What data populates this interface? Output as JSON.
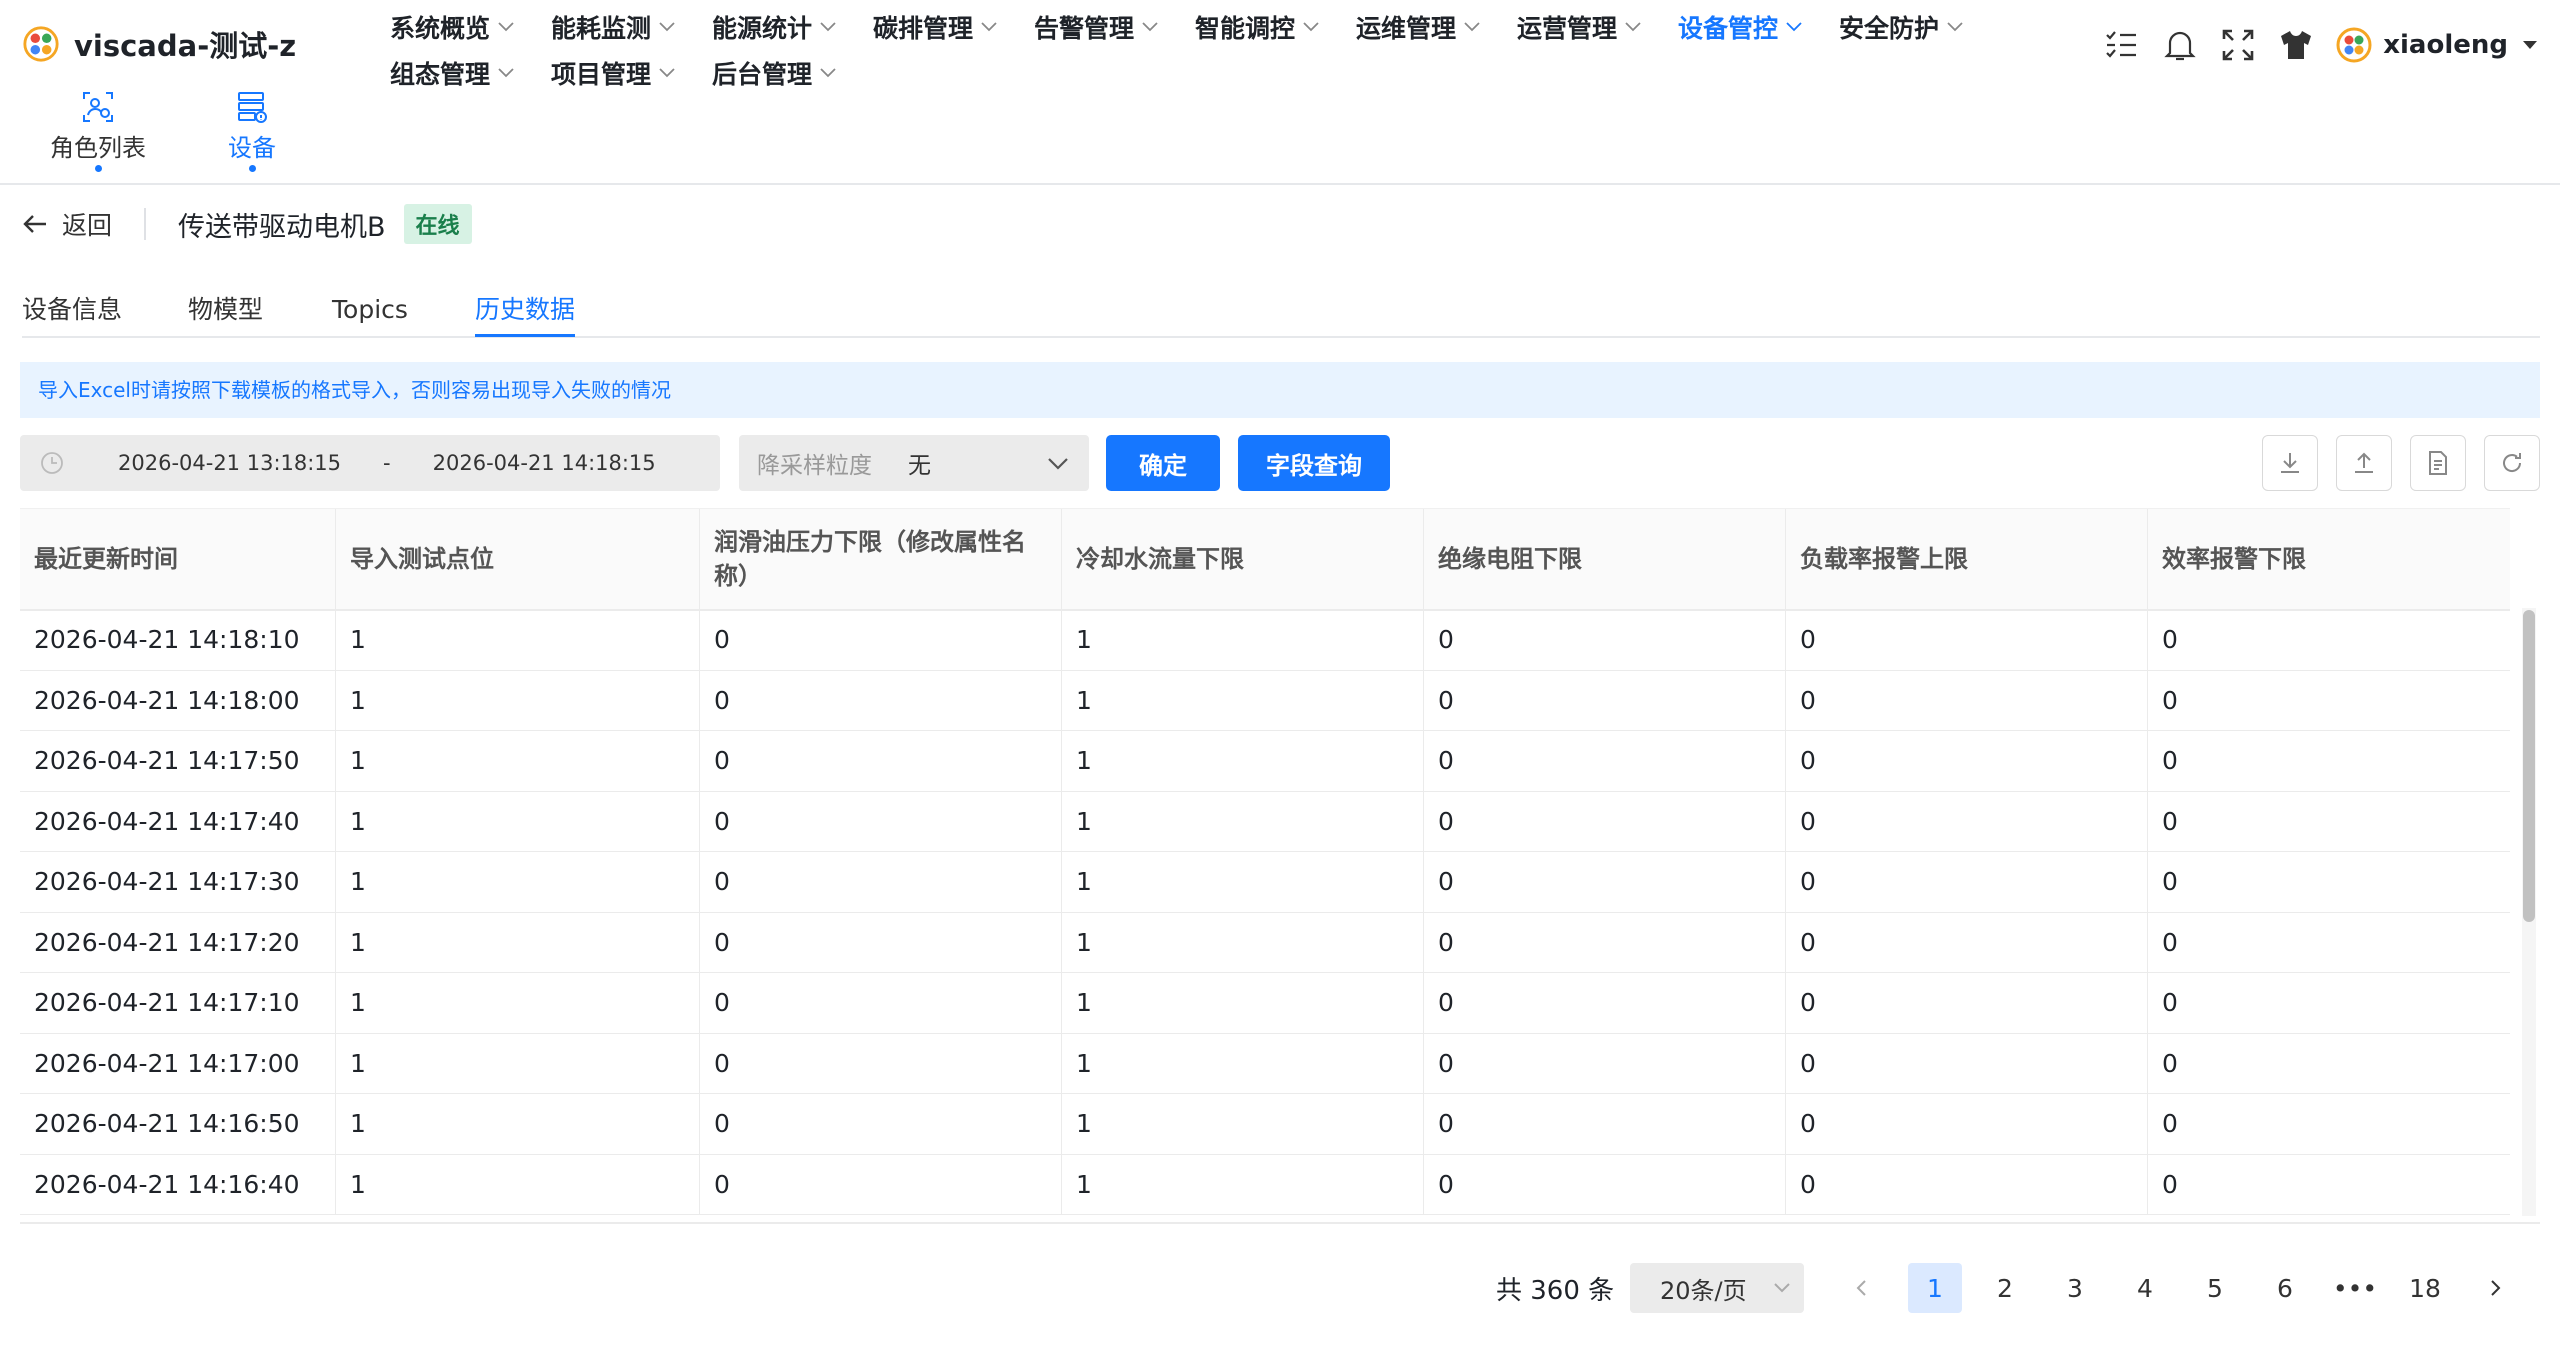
{
  "app": {
    "title": "viscada-测试-z",
    "user": "xiaoleng"
  },
  "nav": {
    "row1": [
      "系统概览",
      "能耗监测",
      "能源统计",
      "碳排管理",
      "告警管理",
      "智能调控",
      "运维管理",
      "运营管理",
      "设备管控",
      "安全防护"
    ],
    "row2": [
      "组态管理",
      "项目管理",
      "后台管理"
    ],
    "active": "设备管控"
  },
  "subnav": {
    "roles": "角色列表",
    "device": "设备"
  },
  "device": {
    "back": "返回",
    "name": "传送带驱动电机B",
    "status": "在线"
  },
  "tabs": [
    "设备信息",
    "物模型",
    "Topics",
    "历史数据"
  ],
  "alert": "导入Excel时请按照下载模板的格式导入，否则容易出现导入失败的情况",
  "filter": {
    "start": "2026-04-21 13:18:15",
    "dash": "-",
    "end": "2026-04-21 14:18:15",
    "sample_placeholder": "降采样粒度",
    "sample_value": "无",
    "confirm": "确定",
    "field_query": "字段查询"
  },
  "table": {
    "columns": [
      "最近更新时间",
      "导入测试点位",
      "润滑油压力下限（修改属性名称）",
      "冷却水流量下限",
      "绝缘电阻下限",
      "负载率报警上限",
      "效率报警下限"
    ],
    "rows": [
      [
        "2026-04-21 14:18:10",
        "1",
        "0",
        "1",
        "0",
        "0",
        "0"
      ],
      [
        "2026-04-21 14:18:00",
        "1",
        "0",
        "1",
        "0",
        "0",
        "0"
      ],
      [
        "2026-04-21 14:17:50",
        "1",
        "0",
        "1",
        "0",
        "0",
        "0"
      ],
      [
        "2026-04-21 14:17:40",
        "1",
        "0",
        "1",
        "0",
        "0",
        "0"
      ],
      [
        "2026-04-21 14:17:30",
        "1",
        "0",
        "1",
        "0",
        "0",
        "0"
      ],
      [
        "2026-04-21 14:17:20",
        "1",
        "0",
        "1",
        "0",
        "0",
        "0"
      ],
      [
        "2026-04-21 14:17:10",
        "1",
        "0",
        "1",
        "0",
        "0",
        "0"
      ],
      [
        "2026-04-21 14:17:00",
        "1",
        "0",
        "1",
        "0",
        "0",
        "0"
      ],
      [
        "2026-04-21 14:16:50",
        "1",
        "0",
        "1",
        "0",
        "0",
        "0"
      ],
      [
        "2026-04-21 14:16:40",
        "1",
        "0",
        "1",
        "0",
        "0",
        "0"
      ]
    ]
  },
  "pagination": {
    "total": "共 360 条",
    "page_size": "20条/页",
    "pages": [
      "1",
      "2",
      "3",
      "4",
      "5",
      "6",
      "•••",
      "18"
    ],
    "current": "1"
  },
  "colors": {
    "accent": "#1677ff",
    "online_bg": "#d7f2e4",
    "online_text": "#1a7f4b",
    "alert_bg": "#e8f3ff"
  }
}
